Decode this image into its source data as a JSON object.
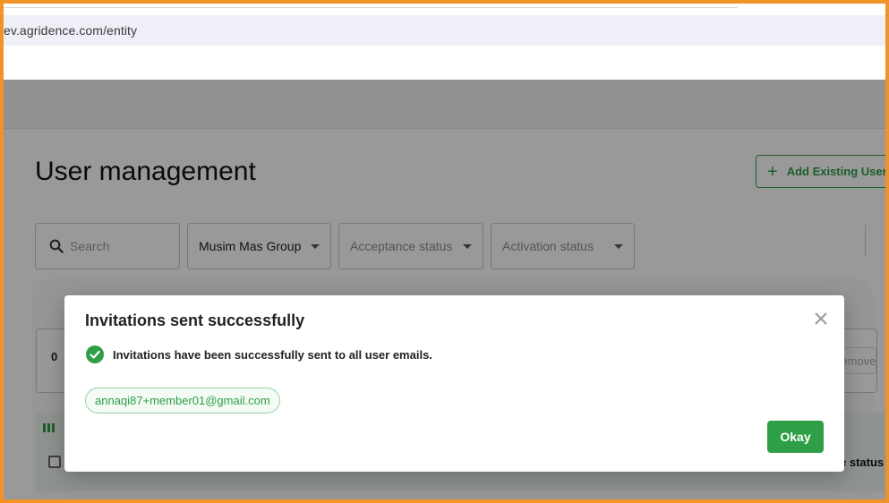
{
  "browser": {
    "url": "ev.agridence.com/entity"
  },
  "page": {
    "title": "User management",
    "add_button_label": "Add Existing User",
    "filters": {
      "search_placeholder": "Search",
      "group_value": "Musim Mas Group",
      "acceptance_placeholder": "Acceptance status",
      "activation_placeholder": "Activation status"
    },
    "selection": {
      "count": "0",
      "remove_label": "Remove"
    },
    "table": {
      "partial_column_header": "e status"
    }
  },
  "modal": {
    "title": "Invitations sent successfully",
    "message": "Invitations have been successfully sent to all user emails.",
    "emails": [
      "annaqi87+member01@gmail.com"
    ],
    "okay_label": "Okay"
  },
  "colors": {
    "accent": "#2e9e47",
    "frame": "#f2932a",
    "chip_border": "#9bd3a6"
  },
  "icons": [
    "search-icon",
    "chevron-down-icon",
    "plus-icon",
    "close-icon",
    "check-circle-icon"
  ]
}
